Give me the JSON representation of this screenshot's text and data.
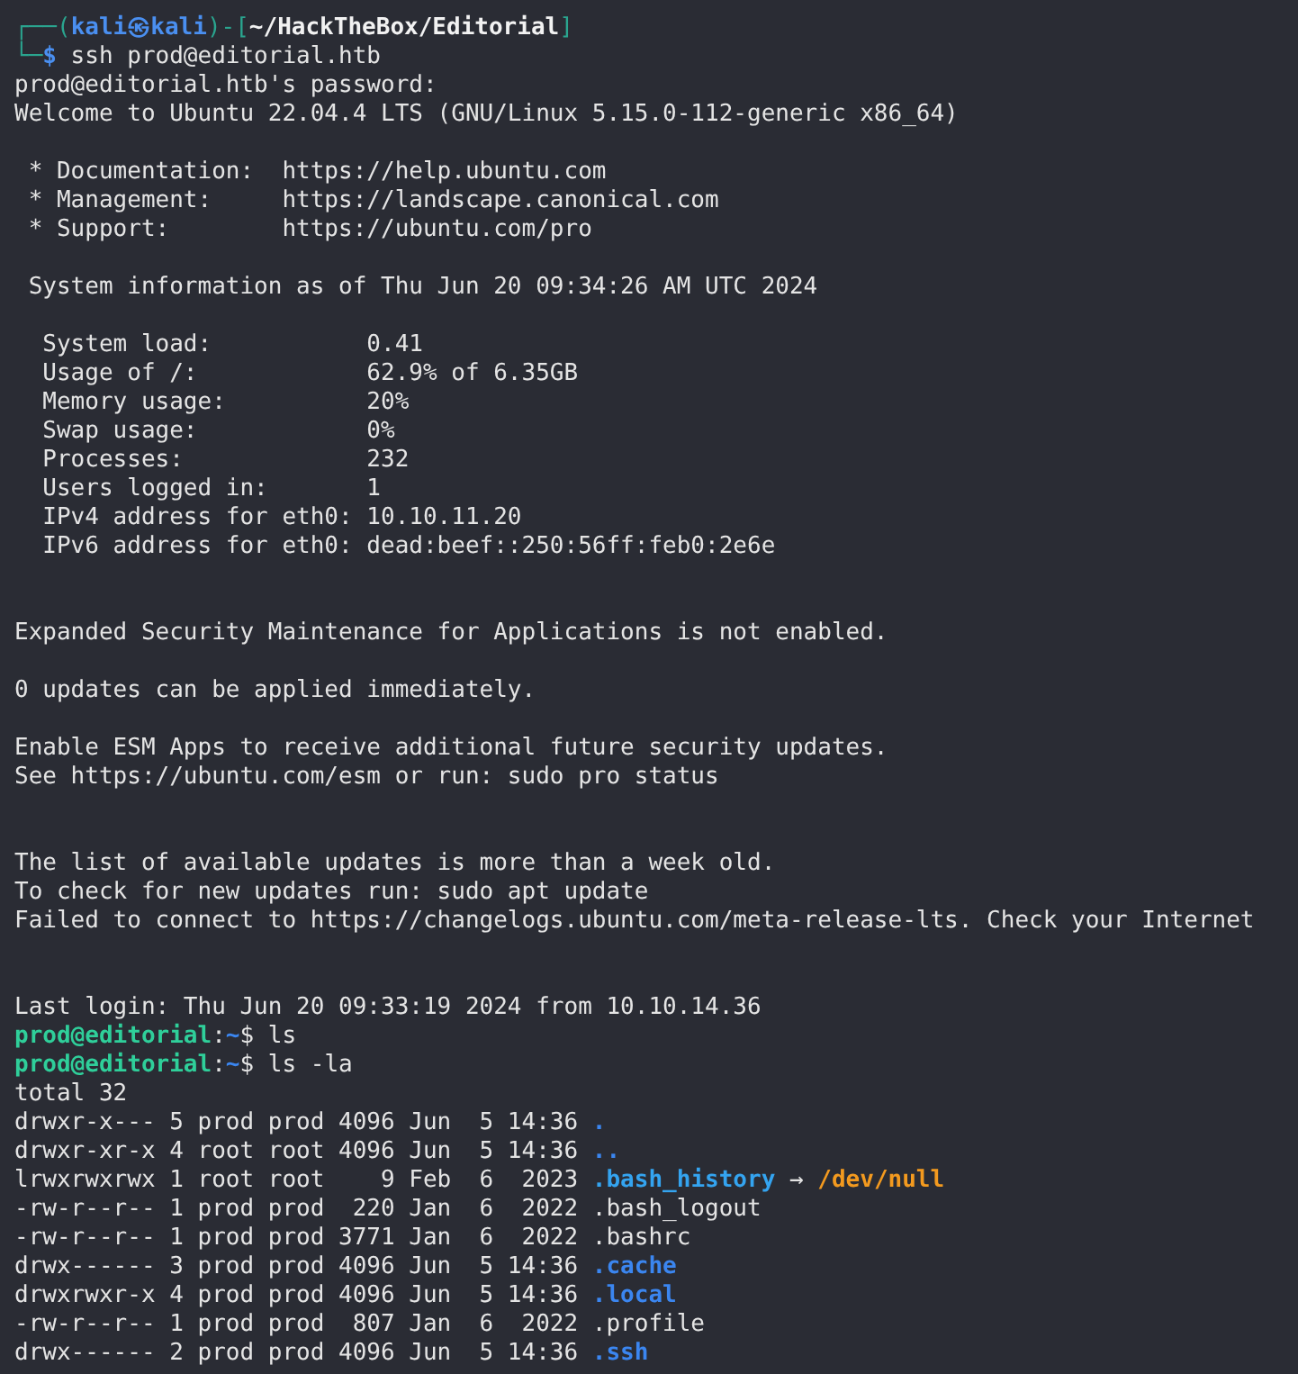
{
  "terminal": {
    "lines": [
      {
        "kind": "text",
        "segments": [
          {
            "kind": "frame",
            "text": "┌──("
          },
          {
            "kind": "host",
            "text": "kali㉿kali"
          },
          {
            "kind": "frame",
            "text": ")-["
          },
          {
            "kind": "cwd",
            "text": "~/HackTheBox/Editorial"
          },
          {
            "kind": "frame",
            "text": "]"
          }
        ]
      },
      {
        "kind": "text",
        "segments": [
          {
            "kind": "frame",
            "text": "└─"
          },
          {
            "kind": "dollar",
            "text": "$"
          },
          {
            "kind": "plain",
            "text": " ssh prod@editorial.htb"
          }
        ]
      },
      {
        "kind": "text",
        "segments": [
          {
            "kind": "plain",
            "text": "prod@editorial.htb's password:"
          }
        ]
      },
      {
        "kind": "text",
        "segments": [
          {
            "kind": "plain",
            "text": "Welcome to Ubuntu 22.04.4 LTS (GNU/Linux 5.15.0-112-generic x86_64)"
          }
        ]
      },
      {
        "kind": "blank"
      },
      {
        "kind": "text",
        "segments": [
          {
            "kind": "plain",
            "text": " * Documentation:  https://help.ubuntu.com"
          }
        ]
      },
      {
        "kind": "text",
        "segments": [
          {
            "kind": "plain",
            "text": " * Management:     https://landscape.canonical.com"
          }
        ]
      },
      {
        "kind": "text",
        "segments": [
          {
            "kind": "plain",
            "text": " * Support:        https://ubuntu.com/pro"
          }
        ]
      },
      {
        "kind": "blank"
      },
      {
        "kind": "text",
        "segments": [
          {
            "kind": "plain",
            "text": " System information as of Thu Jun 20 09:34:26 AM UTC 2024"
          }
        ]
      },
      {
        "kind": "blank"
      },
      {
        "kind": "text",
        "segments": [
          {
            "kind": "plain",
            "text": "  System load:           0.41"
          }
        ]
      },
      {
        "kind": "text",
        "segments": [
          {
            "kind": "plain",
            "text": "  Usage of /:            62.9% of 6.35GB"
          }
        ]
      },
      {
        "kind": "text",
        "segments": [
          {
            "kind": "plain",
            "text": "  Memory usage:          20%"
          }
        ]
      },
      {
        "kind": "text",
        "segments": [
          {
            "kind": "plain",
            "text": "  Swap usage:            0%"
          }
        ]
      },
      {
        "kind": "text",
        "segments": [
          {
            "kind": "plain",
            "text": "  Processes:             232"
          }
        ]
      },
      {
        "kind": "text",
        "segments": [
          {
            "kind": "plain",
            "text": "  Users logged in:       1"
          }
        ]
      },
      {
        "kind": "text",
        "segments": [
          {
            "kind": "plain",
            "text": "  IPv4 address for eth0: 10.10.11.20"
          }
        ]
      },
      {
        "kind": "text",
        "segments": [
          {
            "kind": "plain",
            "text": "  IPv6 address for eth0: dead:beef::250:56ff:feb0:2e6e"
          }
        ]
      },
      {
        "kind": "blank"
      },
      {
        "kind": "blank"
      },
      {
        "kind": "text",
        "segments": [
          {
            "kind": "plain",
            "text": "Expanded Security Maintenance for Applications is not enabled."
          }
        ]
      },
      {
        "kind": "blank"
      },
      {
        "kind": "text",
        "segments": [
          {
            "kind": "plain",
            "text": "0 updates can be applied immediately."
          }
        ]
      },
      {
        "kind": "blank"
      },
      {
        "kind": "text",
        "segments": [
          {
            "kind": "plain",
            "text": "Enable ESM Apps to receive additional future security updates."
          }
        ]
      },
      {
        "kind": "text",
        "segments": [
          {
            "kind": "plain",
            "text": "See https://ubuntu.com/esm or run: sudo pro status"
          }
        ]
      },
      {
        "kind": "blank"
      },
      {
        "kind": "blank"
      },
      {
        "kind": "text",
        "segments": [
          {
            "kind": "plain",
            "text": "The list of available updates is more than a week old."
          }
        ]
      },
      {
        "kind": "text",
        "segments": [
          {
            "kind": "plain",
            "text": "To check for new updates run: sudo apt update"
          }
        ]
      },
      {
        "kind": "text",
        "segments": [
          {
            "kind": "plain",
            "text": "Failed to connect to https://changelogs.ubuntu.com/meta-release-lts. Check your Internet"
          }
        ]
      },
      {
        "kind": "blank"
      },
      {
        "kind": "blank"
      },
      {
        "kind": "text",
        "segments": [
          {
            "kind": "plain",
            "text": "Last login: Thu Jun 20 09:33:19 2024 from 10.10.14.36"
          }
        ]
      },
      {
        "kind": "text",
        "segments": [
          {
            "kind": "user",
            "text": "prod@editorial"
          },
          {
            "kind": "plain",
            "text": ":"
          },
          {
            "kind": "dir",
            "text": "~"
          },
          {
            "kind": "plain",
            "text": "$ ls"
          }
        ]
      },
      {
        "kind": "text",
        "segments": [
          {
            "kind": "user",
            "text": "prod@editorial"
          },
          {
            "kind": "plain",
            "text": ":"
          },
          {
            "kind": "dir",
            "text": "~"
          },
          {
            "kind": "plain",
            "text": "$ ls -la"
          }
        ]
      },
      {
        "kind": "text",
        "segments": [
          {
            "kind": "plain",
            "text": "total 32"
          }
        ]
      },
      {
        "kind": "text",
        "segments": [
          {
            "kind": "plain",
            "text": "drwxr-x--- 5 prod prod 4096 Jun  5 14:36 "
          },
          {
            "kind": "dir",
            "text": "."
          }
        ]
      },
      {
        "kind": "text",
        "segments": [
          {
            "kind": "plain",
            "text": "drwxr-xr-x 4 root root 4096 Jun  5 14:36 "
          },
          {
            "kind": "dir",
            "text": ".."
          }
        ]
      },
      {
        "kind": "text",
        "segments": [
          {
            "kind": "plain",
            "text": "lrwxrwxrwx 1 root root    9 Feb  6  2023 "
          },
          {
            "kind": "link",
            "text": ".bash_history"
          },
          {
            "kind": "plain",
            "text": " → "
          },
          {
            "kind": "target",
            "text": "/dev/null"
          }
        ]
      },
      {
        "kind": "text",
        "segments": [
          {
            "kind": "plain",
            "text": "-rw-r--r-- 1 prod prod  220 Jan  6  2022 .bash_logout"
          }
        ]
      },
      {
        "kind": "text",
        "segments": [
          {
            "kind": "plain",
            "text": "-rw-r--r-- 1 prod prod 3771 Jan  6  2022 .bashrc"
          }
        ]
      },
      {
        "kind": "text",
        "segments": [
          {
            "kind": "plain",
            "text": "drwx------ 3 prod prod 4096 Jun  5 14:36 "
          },
          {
            "kind": "dir",
            "text": ".cache"
          }
        ]
      },
      {
        "kind": "text",
        "segments": [
          {
            "kind": "plain",
            "text": "drwxrwxr-x 4 prod prod 4096 Jun  5 14:36 "
          },
          {
            "kind": "dir",
            "text": ".local"
          }
        ]
      },
      {
        "kind": "text",
        "segments": [
          {
            "kind": "plain",
            "text": "-rw-r--r-- 1 prod prod  807 Jan  6  2022 .profile"
          }
        ]
      },
      {
        "kind": "text",
        "segments": [
          {
            "kind": "plain",
            "text": "drwx------ 2 prod prod 4096 Jun  5 14:36 "
          },
          {
            "kind": "dir",
            "text": ".ssh"
          }
        ]
      }
    ]
  }
}
